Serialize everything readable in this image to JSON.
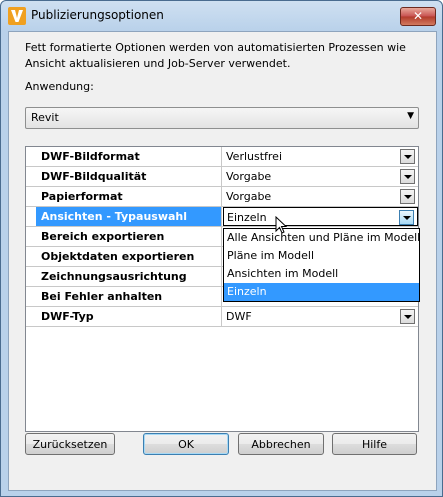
{
  "window": {
    "title": "Publizierungsoptionen",
    "close_glyph": "✕",
    "app_icon": "autodesk-v-icon"
  },
  "description": "Fett formatierte Optionen werden von automatisierten Prozessen wie Ansicht aktualisieren und Job-Server verwendet.",
  "application": {
    "label": "Anwendung:",
    "value": "Revit"
  },
  "properties": [
    {
      "name": "DWF-Bildformat",
      "value": "Verlustfrei"
    },
    {
      "name": "DWF-Bildqualität",
      "value": "Vorgabe"
    },
    {
      "name": "Papierformat",
      "value": "Vorgabe"
    },
    {
      "name": "Ansichten - Typauswahl",
      "value": "Einzeln"
    },
    {
      "name": "Bereich exportieren",
      "value": ""
    },
    {
      "name": "Objektdaten exportieren",
      "value": ""
    },
    {
      "name": "Zeichnungsausrichtung",
      "value": ""
    },
    {
      "name": "Bei Fehler anhalten",
      "value": ""
    },
    {
      "name": "DWF-Typ",
      "value": "DWF"
    }
  ],
  "dropdown": {
    "options": [
      "Alle Ansichten und Pläne im Modell",
      "Pläne im Modell",
      "Ansichten im Modell",
      "Einzeln"
    ],
    "selected_index": 3
  },
  "buttons": {
    "reset": "Zurücksetzen",
    "ok": "OK",
    "cancel": "Abbrechen",
    "help": "Hilfe"
  },
  "colors": {
    "selection": "#3399ff",
    "title_gradient": "#b9d1ea",
    "close_red": "#c75050"
  }
}
